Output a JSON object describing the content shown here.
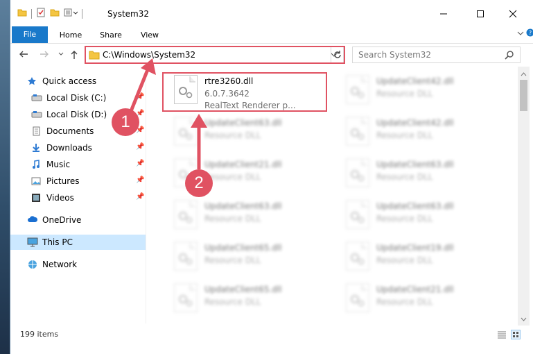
{
  "window": {
    "title": "System32"
  },
  "ribbon": {
    "tabs": [
      "File",
      "Home",
      "Share",
      "View"
    ]
  },
  "address_bar": {
    "path": "C:\\Windows\\System32"
  },
  "search": {
    "placeholder": "Search System32"
  },
  "sidebar": {
    "items": [
      {
        "label": "Quick access",
        "icon": "star-icon",
        "pinned": false
      },
      {
        "label": "Local Disk (C:)",
        "icon": "drive-icon",
        "pinned": true
      },
      {
        "label": "Local Disk (D:)",
        "icon": "drive-icon",
        "pinned": true
      },
      {
        "label": "Documents",
        "icon": "documents-icon",
        "pinned": true
      },
      {
        "label": "Downloads",
        "icon": "download-icon",
        "pinned": true
      },
      {
        "label": "Music",
        "icon": "music-icon",
        "pinned": true
      },
      {
        "label": "Pictures",
        "icon": "pictures-icon",
        "pinned": true
      },
      {
        "label": "Videos",
        "icon": "videos-icon",
        "pinned": true
      },
      {
        "label": "OneDrive",
        "icon": "cloud-icon",
        "pinned": false
      },
      {
        "label": "This PC",
        "icon": "computer-icon",
        "pinned": false,
        "selected": true
      },
      {
        "label": "Network",
        "icon": "network-icon",
        "pinned": false
      }
    ]
  },
  "files": [
    {
      "name": "rtre3260.dll",
      "version": "6.0.7.3642",
      "description": "RealText Renderer p...",
      "highlighted": true
    },
    {
      "name": "UpdateClient42.dll",
      "description": "Resource DLL"
    },
    {
      "name": "UpdateClient63.dll",
      "description": "Resource DLL"
    },
    {
      "name": "UpdateClient42.dll",
      "description": "Resource DLL"
    },
    {
      "name": "UpdateClient21.dll",
      "description": "Resource DLL"
    },
    {
      "name": "UpdateClient63.dll",
      "description": "Resource DLL"
    },
    {
      "name": "UpdateClient63.dll",
      "description": "Resource DLL"
    },
    {
      "name": "UpdateClient63.dll",
      "description": "Resource DLL"
    },
    {
      "name": "UpdateClient65.dll",
      "description": "Resource DLL"
    },
    {
      "name": "UpdateClient19.dll",
      "description": "Resource DLL"
    },
    {
      "name": "UpdateClient65.dll",
      "description": "Resource DLL"
    },
    {
      "name": "UpdateClient21.dll",
      "description": "Resource DLL"
    }
  ],
  "status": {
    "item_count": "199 items"
  },
  "annotations": {
    "step1": "1",
    "step2": "2",
    "color": "#e05262"
  }
}
